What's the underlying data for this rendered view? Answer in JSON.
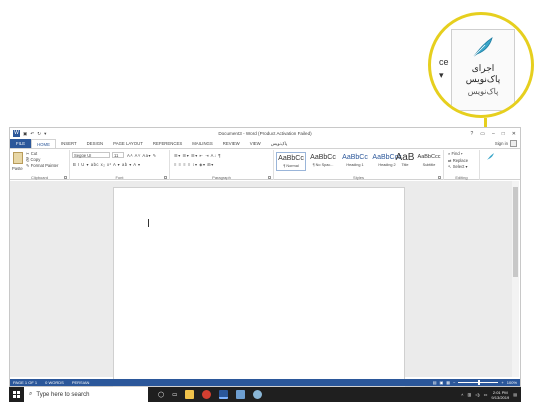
{
  "callout": {
    "button_line1": "اجرای",
    "button_line2": "پاک‌نویس",
    "group_label": "پاک‌نویس",
    "side_text_1": "ce",
    "side_text_2": "▾"
  },
  "window": {
    "title": "Document3 - Word (Product Activation Failed)",
    "help": "?",
    "controls": [
      "▭",
      "–",
      "□",
      "✕"
    ]
  },
  "tabs": [
    "FILE",
    "HOME",
    "INSERT",
    "DESIGN",
    "PAGE LAYOUT",
    "REFERENCES",
    "MAILINGS",
    "REVIEW",
    "VIEW",
    "پاک‌نویس"
  ],
  "signin": "Sign in",
  "clipboard": {
    "paste": "Paste",
    "cut": "Cut",
    "copy": "Copy",
    "format_painter": "Format Painter",
    "label": "Clipboard"
  },
  "font": {
    "name": "Segoe UI",
    "size": "11",
    "row1_tools": "A˄ A˅  Aa▾  ✎",
    "row2_tools": "B  I  U ▾  abc  x₂  x²   A ▾  ab ▾  A ▾",
    "label": "Font"
  },
  "paragraph": {
    "row1_tools": "☰▾  ☰▾  ☰▾   ⇤  ⇥   A↓  ¶",
    "row2_tools": "≡  ≡  ≡  ≡   ↕▾   ◈▾  ⊞▾",
    "label": "Paragraph"
  },
  "styles": {
    "items": [
      {
        "sample": "AaBbCc",
        "name": "¶ Normal"
      },
      {
        "sample": "AaBbCc",
        "name": "¶ No Spac..."
      },
      {
        "sample": "AaBbCc",
        "name": "Heading 1"
      },
      {
        "sample": "AaBbCcc",
        "name": "Heading 2"
      },
      {
        "sample": "AaB",
        "name": "Title"
      },
      {
        "sample": "AaBbCcc",
        "name": "Subtitle"
      }
    ],
    "label": "Styles"
  },
  "editing": {
    "find": "Find ▾",
    "replace": "Replace",
    "select": "Select ▾",
    "label": "Editing"
  },
  "status": {
    "page": "PAGE 1 OF 1",
    "words": "0 WORDS",
    "language": "PERSIAN",
    "zoom": "100%"
  },
  "taskbar": {
    "search_placeholder": "Type here to search",
    "time": "2:01 PM",
    "date": "9/13/2019"
  },
  "colors": {
    "word_blue": "#2b579a",
    "callout_yellow": "#e6cf1e",
    "taskbar": "#1f1f1f"
  }
}
